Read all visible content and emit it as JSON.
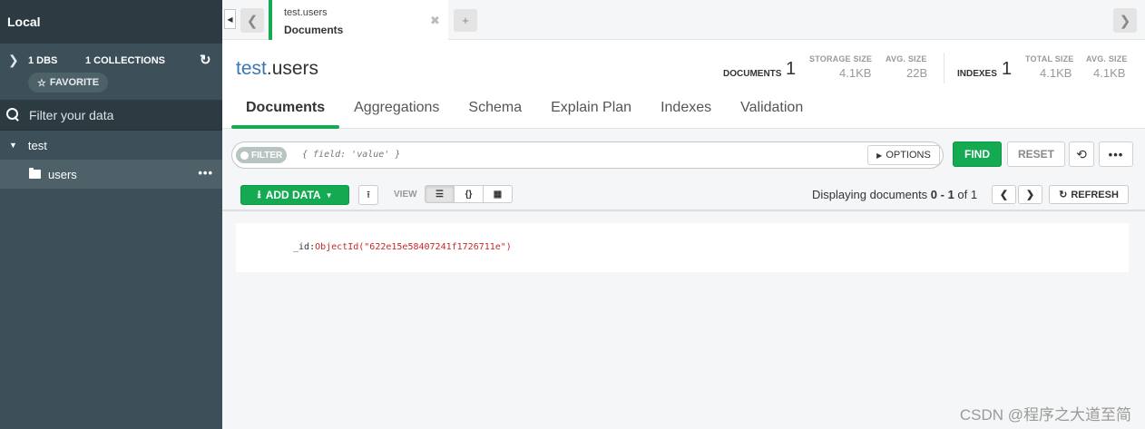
{
  "sidebar": {
    "title": "Local",
    "dbs_count": "1 DBS",
    "collections_count": "1 COLLECTIONS",
    "favorite_label": "FAVORITE",
    "filter_placeholder": "Filter your data",
    "database": "test",
    "collection": "users"
  },
  "tab": {
    "namespace": "test.users",
    "label": "Documents"
  },
  "header": {
    "db": "test",
    "collection": ".users",
    "documents_label": "DOCUMENTS",
    "documents_count": "1",
    "storage_size_label": "STORAGE SIZE",
    "storage_size": "4.1KB",
    "avg_size_label": "AVG. SIZE",
    "avg_size": "22B",
    "indexes_label": "INDEXES",
    "indexes_count": "1",
    "total_size_label": "TOTAL SIZE",
    "total_size": "4.1KB",
    "index_avg_size_label": "AVG. SIZE",
    "index_avg_size": "4.1KB"
  },
  "subtabs": [
    "Documents",
    "Aggregations",
    "Schema",
    "Explain Plan",
    "Indexes",
    "Validation"
  ],
  "query": {
    "filter_label": "FILTER",
    "placeholder": "{ field: 'value' }",
    "options_label": "OPTIONS",
    "find_label": "FIND",
    "reset_label": "RESET"
  },
  "toolbar": {
    "add_data_label": "ADD DATA",
    "view_label": "VIEW",
    "displaying_prefix": "Displaying documents ",
    "range": "0 - 1",
    "of_text": " of ",
    "total": "1",
    "refresh_label": "REFRESH"
  },
  "document": {
    "key": "_id",
    "value": "ObjectId(\"622e15e58407241f1726711e\")"
  },
  "watermark": "CSDN @程序之大道至简",
  "colors": {
    "accent": "#13aa52",
    "sidebar": "#3d4f58",
    "link": "#3a77b4"
  }
}
